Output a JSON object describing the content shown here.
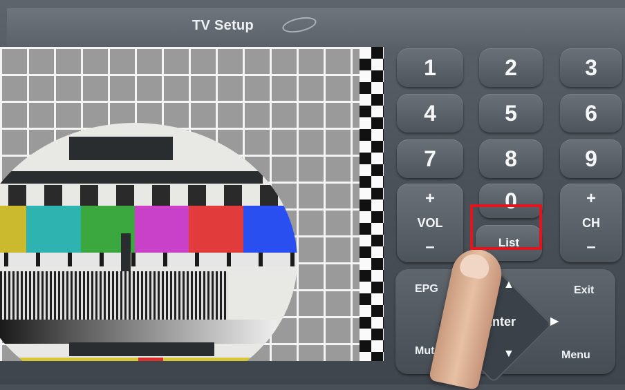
{
  "title": "TV Setup",
  "keypad": {
    "digits": [
      "1",
      "2",
      "3",
      "4",
      "5",
      "6",
      "7",
      "8",
      "9",
      "0"
    ],
    "vol": {
      "plus": "+",
      "label": "VOL",
      "minus": "–"
    },
    "ch": {
      "plus": "+",
      "label": "CH",
      "minus": "–"
    },
    "list": "List"
  },
  "nav": {
    "epg": "EPG",
    "exit": "Exit",
    "mute": "Mute",
    "menu": "Menu",
    "enter": "Enter",
    "up": "▲",
    "down": "▼",
    "left": "◀",
    "right": "▶"
  },
  "pattern_colors": [
    "#cbb92e",
    "#2fb3b0",
    "#3aa83e",
    "#c941c9",
    "#e23b3b",
    "#2a4ff0"
  ],
  "highlight_color": "#e3141b"
}
